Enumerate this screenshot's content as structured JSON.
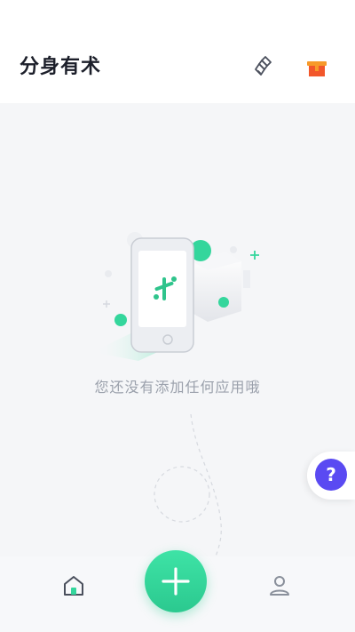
{
  "header": {
    "title": "分身有术",
    "brush_icon": "clean-brush-icon",
    "gift_icon": "gift-box-icon"
  },
  "empty_state": {
    "message": "您还没有添加任何应用哦",
    "illustration": "phone-with-app-logo"
  },
  "help": {
    "label": "?"
  },
  "bottom_nav": {
    "home_icon": "home-icon",
    "add_icon": "plus-icon",
    "profile_icon": "user-icon"
  },
  "colors": {
    "accent_green": "#2fd19a",
    "help_purple": "#5a4af2",
    "gift_orange": "#f2572b"
  }
}
